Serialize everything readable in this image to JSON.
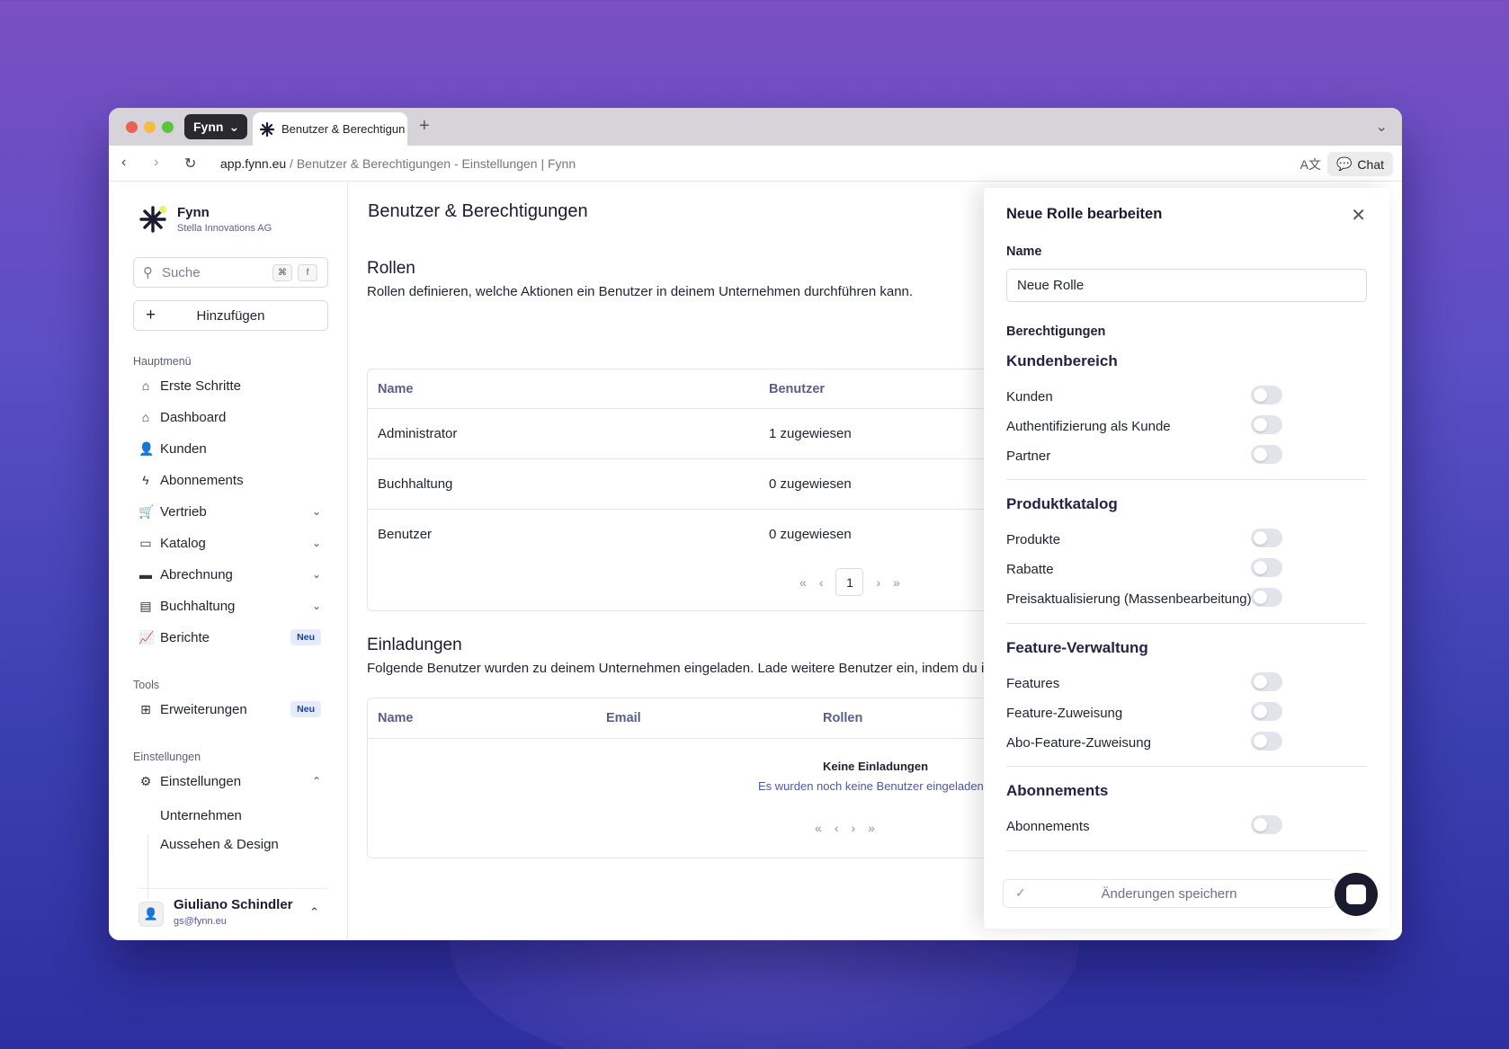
{
  "browser": {
    "profile": "Fynn",
    "tab_title": "Benutzer & Berechtigun",
    "url_host": "app.fynn.eu",
    "url_rest": " / Benutzer & Berechtigungen - Einstellungen | Fynn",
    "chat_label": "Chat"
  },
  "sidebar": {
    "brand_name": "Fynn",
    "brand_company": "Stella Innovations AG",
    "search_placeholder": "Suche",
    "kbd1": "⌘",
    "kbd2": "f",
    "add_label": "Hinzufügen",
    "section_main": "Hauptmenü",
    "main_items": [
      {
        "label": "Erste Schritte",
        "icon": "home-filled-icon"
      },
      {
        "label": "Dashboard",
        "icon": "home-icon"
      },
      {
        "label": "Kunden",
        "icon": "user-icon"
      },
      {
        "label": "Abonnements",
        "icon": "bolt-icon"
      },
      {
        "label": "Vertrieb",
        "icon": "cart-icon"
      },
      {
        "label": "Katalog",
        "icon": "calendar-icon"
      },
      {
        "label": "Abrechnung",
        "icon": "card-icon"
      },
      {
        "label": "Buchhaltung",
        "icon": "calculator-icon"
      },
      {
        "label": "Berichte",
        "icon": "chart-icon",
        "badge": "Neu"
      }
    ],
    "section_tools": "Tools",
    "tools_items": [
      {
        "label": "Erweiterungen",
        "icon": "grid-icon",
        "badge": "Neu"
      }
    ],
    "section_settings": "Einstellungen",
    "settings_item": "Einstellungen",
    "settings_sub": [
      "Unternehmen",
      "Aussehen & Design"
    ],
    "user_name": "Giuliano Schindler",
    "user_email": "gs@fynn.eu"
  },
  "main": {
    "page_title": "Benutzer & Berechtigungen",
    "roles_title": "Rollen",
    "roles_desc": "Rollen definieren, welche Aktionen ein Benutzer in deinem Unternehmen durchführen kann.",
    "roles_headers": [
      "Name",
      "Benutzer"
    ],
    "roles_rows": [
      {
        "name": "Administrator",
        "users": "1 zugewiesen"
      },
      {
        "name": "Buchhaltung",
        "users": "0 zugewiesen"
      },
      {
        "name": "Benutzer",
        "users": "0 zugewiesen"
      }
    ],
    "page_number": "1",
    "invites_title": "Einladungen",
    "invites_desc": "Folgende Benutzer wurden zu deinem Unternehmen eingeladen. Lade weitere Benutzer ein, indem du ihn",
    "invites_headers": [
      "Name",
      "Email",
      "Rollen"
    ],
    "empty_title": "Keine Einladungen",
    "empty_sub": "Es wurden noch keine Benutzer eingeladen."
  },
  "panel": {
    "title": "Neue Rolle bearbeiten",
    "name_label": "Name",
    "name_value": "Neue Rolle",
    "permissions_label": "Berechtigungen",
    "groups": [
      {
        "title": "Kundenbereich",
        "items": [
          "Kunden",
          "Authentifizierung als Kunde",
          "Partner"
        ]
      },
      {
        "title": "Produktkatalog",
        "items": [
          "Produkte",
          "Rabatte",
          "Preisaktualisierung (Massenbearbeitung)"
        ]
      },
      {
        "title": "Feature-Verwaltung",
        "items": [
          "Features",
          "Feature-Zuweisung",
          "Abo-Feature-Zuweisung"
        ]
      },
      {
        "title": "Abonnements",
        "items": [
          "Abonnements"
        ]
      }
    ],
    "save_label": "Änderungen speichern"
  }
}
